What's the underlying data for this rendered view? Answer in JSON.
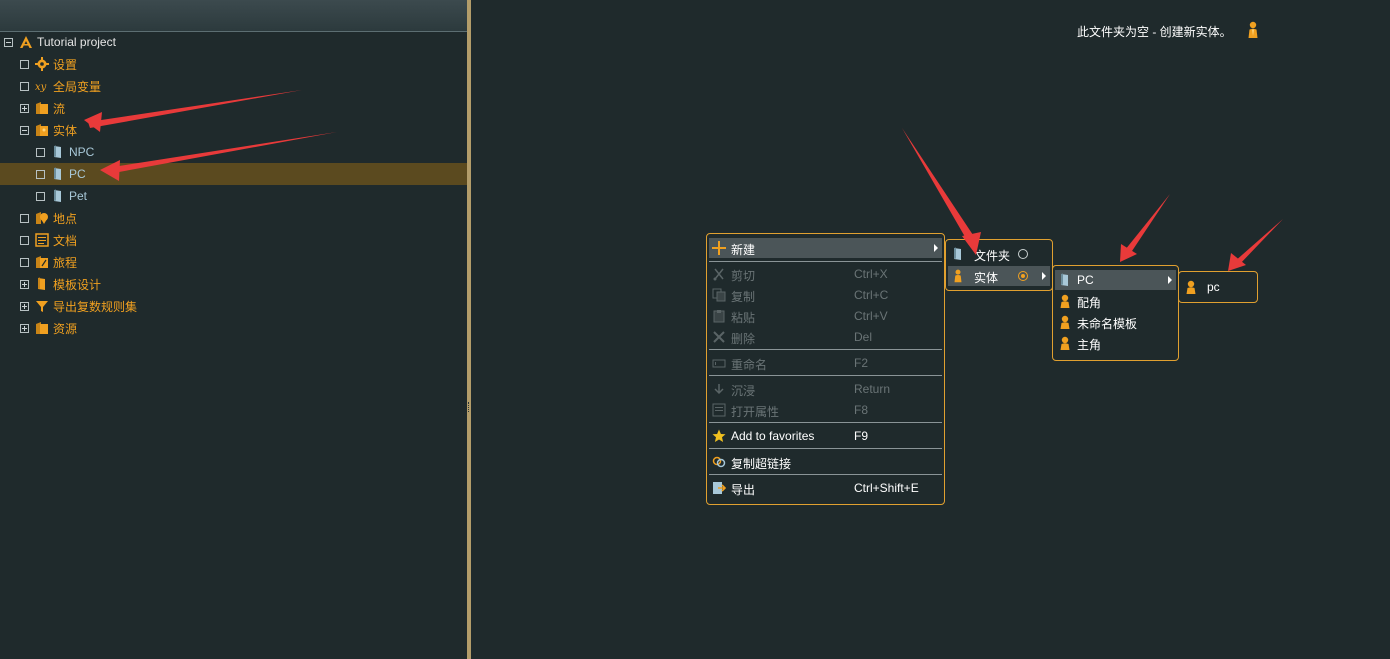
{
  "tree": {
    "items": [
      {
        "label": "Tutorial project",
        "expander": "minus",
        "icon": "project-icon",
        "indent": 0,
        "color": "white"
      },
      {
        "label": "设置",
        "expander": "box",
        "icon": "gear-icon",
        "indent": 1,
        "color": "orange"
      },
      {
        "label": "全局变量",
        "expander": "box",
        "icon": "variable-icon",
        "indent": 1,
        "color": "orange"
      },
      {
        "label": "流",
        "expander": "plus",
        "icon": "folder-icon",
        "indent": 1,
        "color": "orange"
      },
      {
        "label": "实体",
        "expander": "minus",
        "icon": "entity-folder-icon",
        "indent": 1,
        "color": "orange"
      },
      {
        "label": "NPC",
        "expander": "box",
        "icon": "template-icon",
        "indent": 2,
        "color": "blue"
      },
      {
        "label": "PC",
        "expander": "box",
        "icon": "template-icon",
        "indent": 2,
        "color": "blue",
        "selected": true
      },
      {
        "label": "Pet",
        "expander": "box",
        "icon": "template-icon",
        "indent": 2,
        "color": "blue"
      },
      {
        "label": "地点",
        "expander": "box",
        "icon": "location-icon",
        "indent": 1,
        "color": "orange"
      },
      {
        "label": "文档",
        "expander": "box",
        "icon": "document-icon",
        "indent": 1,
        "color": "orange"
      },
      {
        "label": "旅程",
        "expander": "box",
        "icon": "journey-icon",
        "indent": 1,
        "color": "orange"
      },
      {
        "label": "模板设计",
        "expander": "plus",
        "icon": "template-design-icon",
        "indent": 1,
        "color": "orange"
      },
      {
        "label": "导出复数规则集",
        "expander": "plus",
        "icon": "funnel-icon",
        "indent": 1,
        "color": "orange"
      },
      {
        "label": "资源",
        "expander": "plus",
        "icon": "folder-icon",
        "indent": 1,
        "color": "orange"
      }
    ]
  },
  "canvas": {
    "empty_message": "此文件夹为空 - 创建新实体。"
  },
  "context_menu": {
    "new_label": "新建",
    "items": [
      {
        "label": "剪切",
        "shortcut": "Ctrl+X",
        "icon": "cut-icon",
        "disabled": true
      },
      {
        "label": "复制",
        "shortcut": "Ctrl+C",
        "icon": "copy-icon",
        "disabled": true
      },
      {
        "label": "粘贴",
        "shortcut": "Ctrl+V",
        "icon": "paste-icon",
        "disabled": true
      },
      {
        "label": "删除",
        "shortcut": "Del",
        "icon": "delete-icon",
        "disabled": true
      },
      {
        "label": "重命名",
        "shortcut": "F2",
        "icon": "rename-icon",
        "disabled": true
      },
      {
        "label": "沉浸",
        "shortcut": "Return",
        "icon": "immerse-icon",
        "disabled": true
      },
      {
        "label": "打开属性",
        "shortcut": "F8",
        "icon": "properties-icon",
        "disabled": true
      },
      {
        "label": "Add to favorites",
        "shortcut": "F9",
        "icon": "star-icon",
        "disabled": false
      },
      {
        "label": "复制超链接",
        "shortcut": "",
        "icon": "hyperlink-icon",
        "disabled": false
      },
      {
        "label": "导出",
        "shortcut": "Ctrl+Shift+E",
        "icon": "export-icon",
        "disabled": false
      }
    ]
  },
  "new_submenu": {
    "folder_label": "文件夹",
    "entity_label": "实体",
    "selected": "实体"
  },
  "entity_submenu": {
    "items": [
      "PC",
      "配角",
      "未命名模板",
      "主角"
    ]
  },
  "pc_submenu": {
    "items": [
      "pc"
    ]
  },
  "colors": {
    "accent": "#f0a020",
    "background": "#1f2a2c",
    "selection": "#5b4a1f",
    "menu_highlight": "#4b5558",
    "arrow": "#e83a3a"
  }
}
